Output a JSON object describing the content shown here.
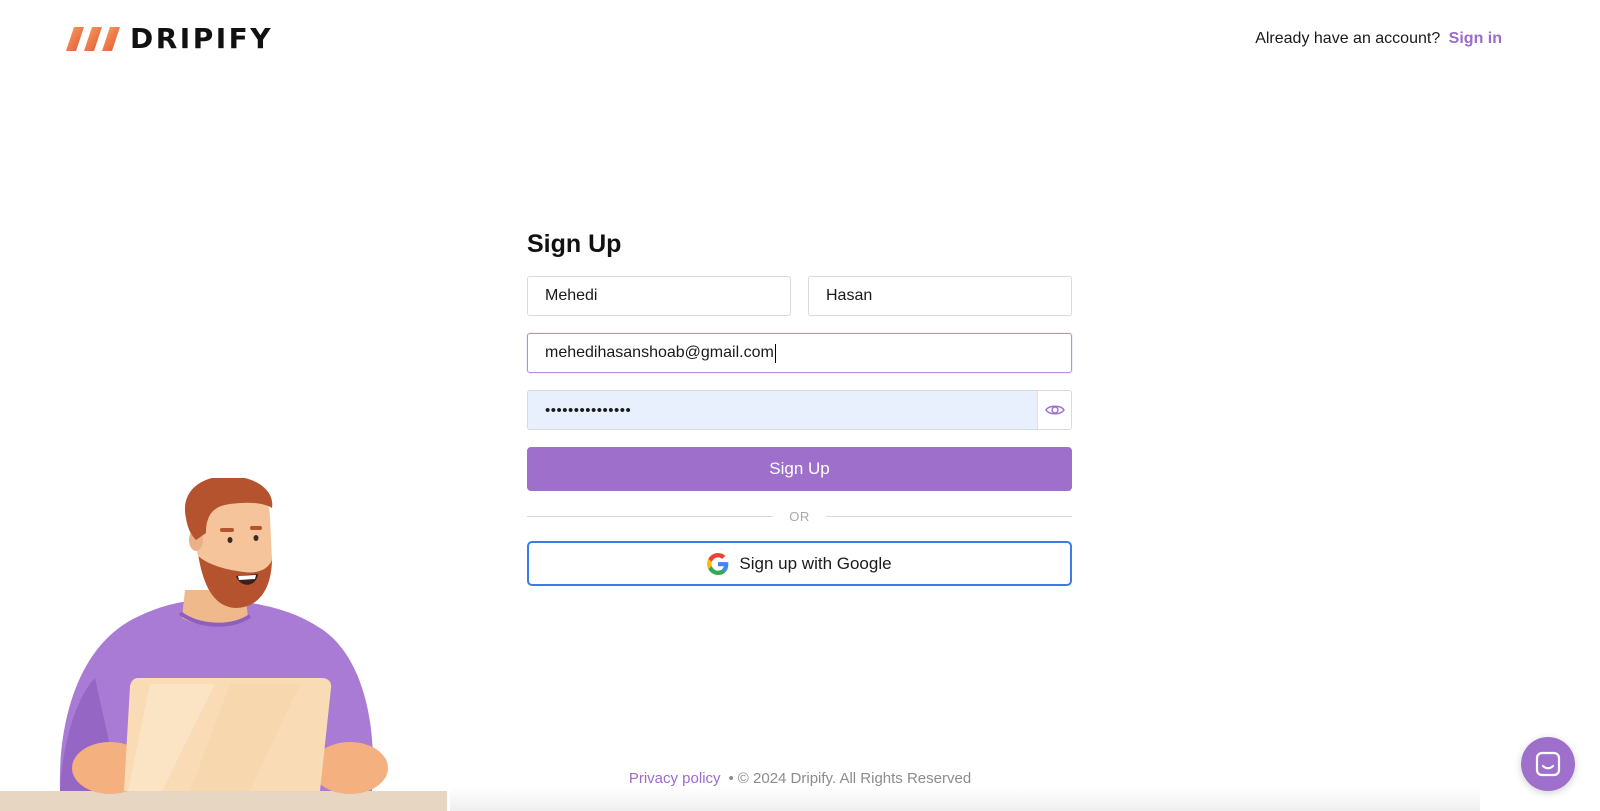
{
  "header": {
    "logo_text": "DRIPIFY",
    "signin_prompt": "Already have an account?",
    "signin_link": "Sign in"
  },
  "form": {
    "title": "Sign Up",
    "first_name_value": "Mehedi",
    "last_name_value": "Hasan",
    "email_value": "mehedihasanshoab@gmail.com",
    "password_value": "•••••••••••••••",
    "submit_label": "Sign Up",
    "divider_text": "OR",
    "google_label": "Sign up with Google"
  },
  "footer": {
    "privacy_label": "Privacy policy",
    "separator": "•",
    "copyright": "© 2024 Dripify. All Rights Reserved"
  },
  "colors": {
    "accent": "#9f70cb",
    "link": "#9b6bcc",
    "google_border": "#3b7bea",
    "autofill_bg": "#e8f0fe",
    "logo_orange": "#f07a4a"
  },
  "icons": {
    "logo_mark": "logo-stripes-icon",
    "eye": "eye-icon",
    "google": "google-g-icon",
    "chat": "chat-icon"
  }
}
